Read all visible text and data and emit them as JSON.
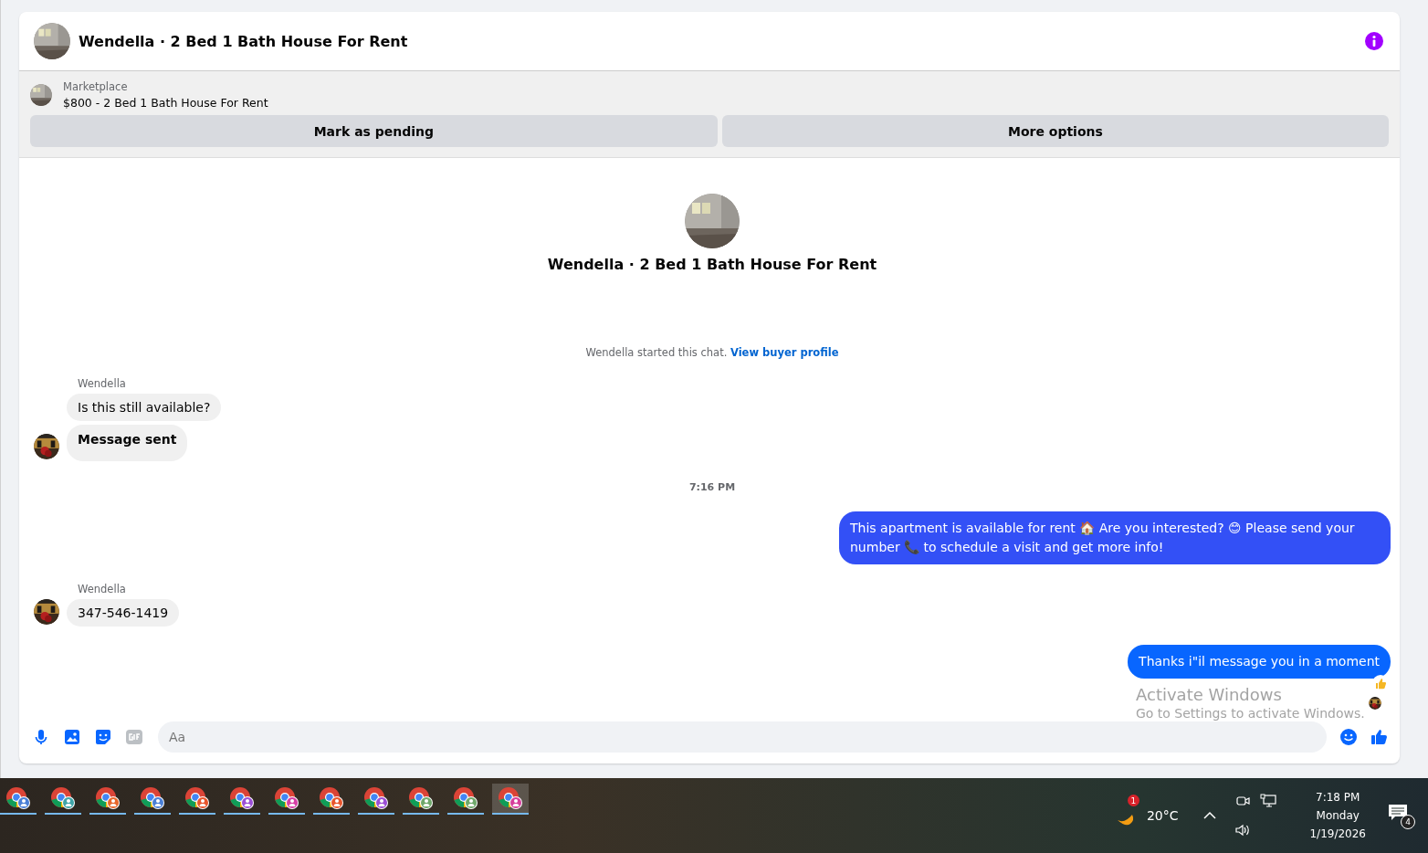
{
  "header": {
    "title": "Wendella · 2 Bed 1 Bath House For Rent"
  },
  "listing": {
    "source": "Marketplace",
    "title": "$800 - 2 Bed 1 Bath House For Rent"
  },
  "actions": [
    {
      "label": "Mark as pending"
    },
    {
      "label": "More options"
    }
  ],
  "intro": {
    "title": "Wendella · 2 Bed 1 Bath House For Rent",
    "notice": "Wendella started this chat.",
    "link": "View buyer profile"
  },
  "messages": [
    {
      "kind": "incoming",
      "sender": "Wendella",
      "bubbles": [
        {
          "kind": "text",
          "text": "Is this still available?"
        },
        {
          "kind": "status",
          "text": "Message sent"
        }
      ]
    },
    {
      "kind": "time",
      "text": "7:16 PM"
    },
    {
      "kind": "outgoing",
      "bubbles": [
        {
          "kind": "text",
          "text": "This apartment is available for rent 🏠 Are you interested? 😊 Please send your number 📞 to schedule a visit and get more info!"
        }
      ]
    },
    {
      "kind": "incoming",
      "sender": "Wendella",
      "bubbles": [
        {
          "kind": "text",
          "text": "347-546-1419"
        }
      ]
    },
    {
      "kind": "outgoing",
      "bubbles": [
        {
          "kind": "text",
          "text": "Thanks i\"il message you in a moment"
        }
      ],
      "liked": true,
      "seen": true
    }
  ],
  "composer": {
    "placeholder": "Aa"
  },
  "watermark": {
    "title": "Activate Windows",
    "subtitle": "Go to Settings to activate Windows."
  },
  "taskbar": {
    "apps": [
      {
        "color": "#4a7fd6",
        "selected": false
      },
      {
        "color": "#3fa5a8",
        "selected": false
      },
      {
        "color": "#e8672c",
        "selected": false
      },
      {
        "color": "#4a7fd6",
        "selected": false
      },
      {
        "color": "#e8552c",
        "selected": false
      },
      {
        "color": "#9b4fd6",
        "selected": false
      },
      {
        "color": "#d63fa5",
        "selected": false
      },
      {
        "color": "#e8552c",
        "selected": false
      },
      {
        "color": "#9b4fd6",
        "selected": false
      },
      {
        "color": "#6fa86a",
        "selected": false
      },
      {
        "color": "#6fa86a",
        "selected": false
      },
      {
        "color": "#d63f9b",
        "selected": true
      }
    ],
    "weather": {
      "temperature": "20°C",
      "badge": "1"
    },
    "clock": {
      "time": "7:18 PM",
      "day": "Monday",
      "date": "1/19/2026"
    },
    "notifications": {
      "count": "4"
    }
  }
}
